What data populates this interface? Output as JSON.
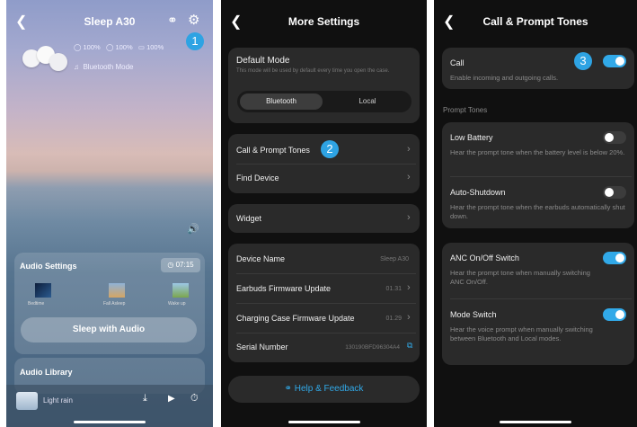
{
  "screen1": {
    "title": "Sleep A30",
    "battery_left": "100%",
    "battery_right": "100%",
    "battery_case": "100%",
    "mode": "Bluetooth Mode",
    "badge": "1",
    "audio_settings": {
      "label": "Audio Settings",
      "timer": "07:15"
    },
    "scenes": [
      {
        "label": "Bedtime"
      },
      {
        "label": "Fall Asleep"
      },
      {
        "label": "Wake up"
      }
    ],
    "sleep_button": "Sleep with Audio",
    "audio_library": "Audio Library",
    "now_playing": "Light rain"
  },
  "screen2": {
    "title": "More Settings",
    "default_mode": {
      "label": "Default Mode",
      "desc": "This mode will be used by default every time you open the case.",
      "options": [
        "Bluetooth",
        "Local"
      ],
      "selected": "Bluetooth"
    },
    "call_prompt": "Call & Prompt Tones",
    "badge": "2",
    "find_device": "Find Device",
    "widget": "Widget",
    "device_name": {
      "label": "Device Name",
      "value": "Sleep A30"
    },
    "earbuds_fw": {
      "label": "Earbuds Firmware Update",
      "value": "01.31"
    },
    "case_fw": {
      "label": "Charging Case Firmware Update",
      "value": "01.29"
    },
    "serial": {
      "label": "Serial Number",
      "value": "130190BFD96304A4"
    },
    "help": "Help & Feedback"
  },
  "screen3": {
    "title": "Call & Prompt Tones",
    "badge": "3",
    "call": {
      "label": "Call",
      "desc": "Enable incoming and outgoing calls.",
      "on": true
    },
    "section": "Prompt Tones",
    "low_battery": {
      "label": "Low Battery",
      "desc": "Hear the prompt tone when the battery level is below 20%.",
      "on": false
    },
    "auto_shutdown": {
      "label": "Auto-Shutdown",
      "desc": "Hear the prompt tone when the earbuds automatically shut down.",
      "on": false
    },
    "anc": {
      "label": "ANC On/Off Switch",
      "desc": "Hear the prompt tone when manually switching ANC On/Off.",
      "on": true
    },
    "mode_switch": {
      "label": "Mode Switch",
      "desc": "Hear the voice prompt when manually switching between Bluetooth and Local modes.",
      "on": true
    }
  },
  "colors": {
    "accent": "#2ea3e3",
    "dark_bg": "#101010",
    "card": "#2a2a2a"
  },
  "icons": [
    "back-icon",
    "headset-icon",
    "gear-icon",
    "battery-icon",
    "speaker-icon",
    "clock-icon",
    "download-icon",
    "play-icon",
    "timer-icon",
    "music-icon",
    "copy-icon",
    "help-icon"
  ]
}
